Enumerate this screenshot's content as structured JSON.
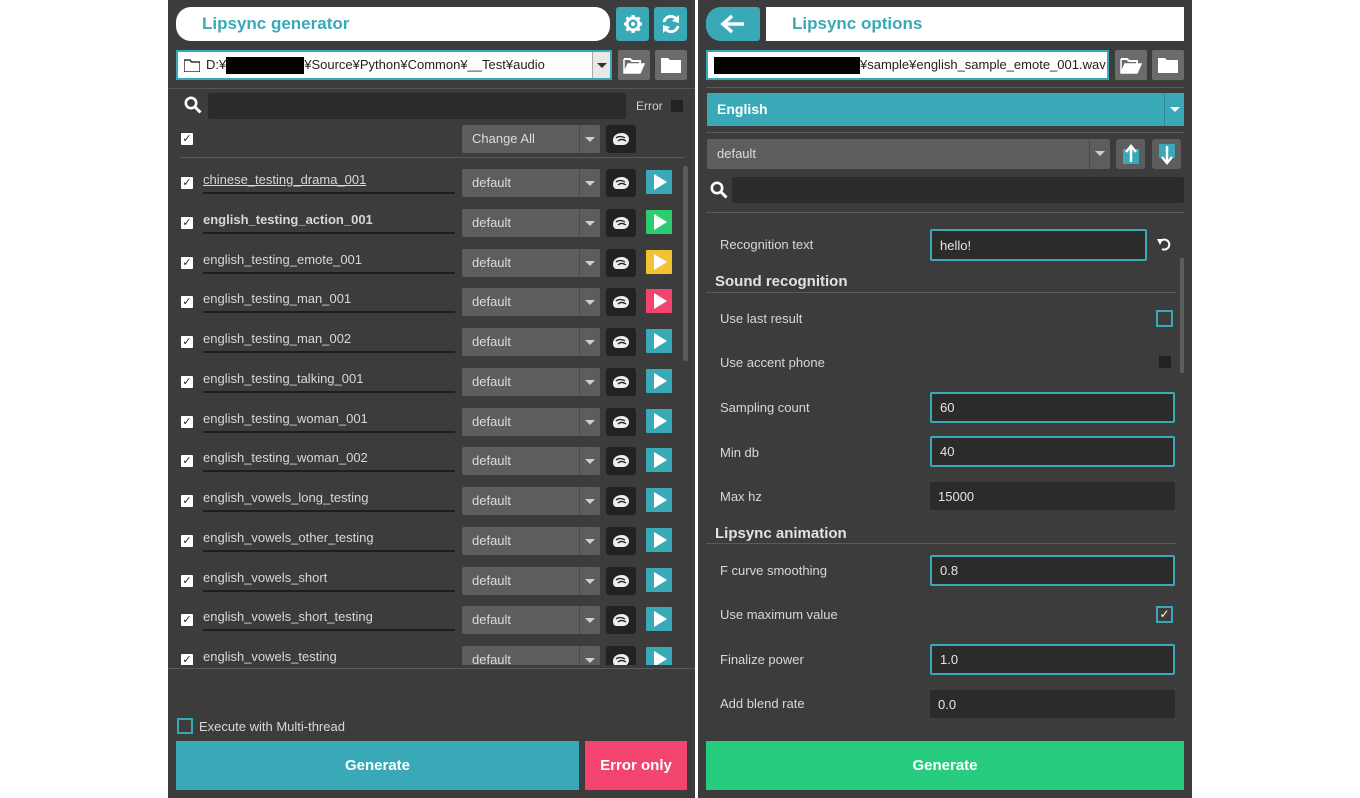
{
  "left": {
    "title": "Lipsync generator",
    "path": {
      "prefix": "D:¥",
      "suffix": "¥Source¥Python¥Common¥__Test¥audio"
    },
    "search": {
      "placeholder": "",
      "error_label": "Error"
    },
    "change_all": "Change All",
    "rows": [
      {
        "name": "chinese_testing_drama_001",
        "preset": "default",
        "play_color": "#3aa9b7"
      },
      {
        "name": "english_testing_action_001",
        "preset": "default",
        "play_color": "#2ecc71"
      },
      {
        "name": "english_testing_emote_001",
        "preset": "default",
        "play_color": "#f1c232"
      },
      {
        "name": "english_testing_man_001",
        "preset": "default",
        "play_color": "#f2446e"
      },
      {
        "name": "english_testing_man_002",
        "preset": "default",
        "play_color": "#3aa9b7"
      },
      {
        "name": "english_testing_talking_001",
        "preset": "default",
        "play_color": "#3aa9b7"
      },
      {
        "name": "english_testing_woman_001",
        "preset": "default",
        "play_color": "#3aa9b7"
      },
      {
        "name": "english_testing_woman_002",
        "preset": "default",
        "play_color": "#3aa9b7"
      },
      {
        "name": "english_vowels_long_testing",
        "preset": "default",
        "play_color": "#3aa9b7"
      },
      {
        "name": "english_vowels_other_testing",
        "preset": "default",
        "play_color": "#3aa9b7"
      },
      {
        "name": "english_vowels_short",
        "preset": "default",
        "play_color": "#3aa9b7"
      },
      {
        "name": "english_vowels_short_testing",
        "preset": "default",
        "play_color": "#3aa9b7"
      },
      {
        "name": "english_vowels_testing",
        "preset": "default",
        "play_color": "#3aa9b7"
      }
    ],
    "multithread_label": "Execute with Multi-thread",
    "generate_label": "Generate",
    "error_only_label": "Error only"
  },
  "right": {
    "title": "Lipsync options",
    "path_suffix": "¥sample¥english_sample_emote_001.wav",
    "language": "English",
    "preset": "default",
    "recognition_text": {
      "label": "Recognition text",
      "value": "hello!"
    },
    "sound_section": "Sound recognition",
    "use_last_result": {
      "label": "Use last result",
      "checked": false
    },
    "use_accent_phone": {
      "label": "Use accent phone",
      "checked": false
    },
    "sampling_count": {
      "label": "Sampling count",
      "value": "60"
    },
    "min_db": {
      "label": "Min db",
      "value": "40"
    },
    "max_hz": {
      "label": "Max hz",
      "value": "15000"
    },
    "anim_section": "Lipsync animation",
    "f_curve_smoothing": {
      "label": "F curve smoothing",
      "value": "0.8"
    },
    "use_maximum_value": {
      "label": "Use maximum value",
      "checked": true
    },
    "finalize_power": {
      "label": "Finalize power",
      "value": "1.0"
    },
    "add_blend_rate": {
      "label": "Add blend rate",
      "value": "0.0"
    },
    "generate_label": "Generate"
  },
  "colors": {
    "accent": "#3aa9b7",
    "generate_green": "#27cc7e",
    "error_red": "#f2446e",
    "panel": "#3c3c3c"
  },
  "icons": [
    "gear-icon",
    "refresh-icon",
    "folder-icon",
    "open-folder-icon",
    "search-icon",
    "hair-icon",
    "play-icon",
    "back-arrow-icon",
    "upload-icon",
    "download-icon",
    "undo-icon"
  ]
}
